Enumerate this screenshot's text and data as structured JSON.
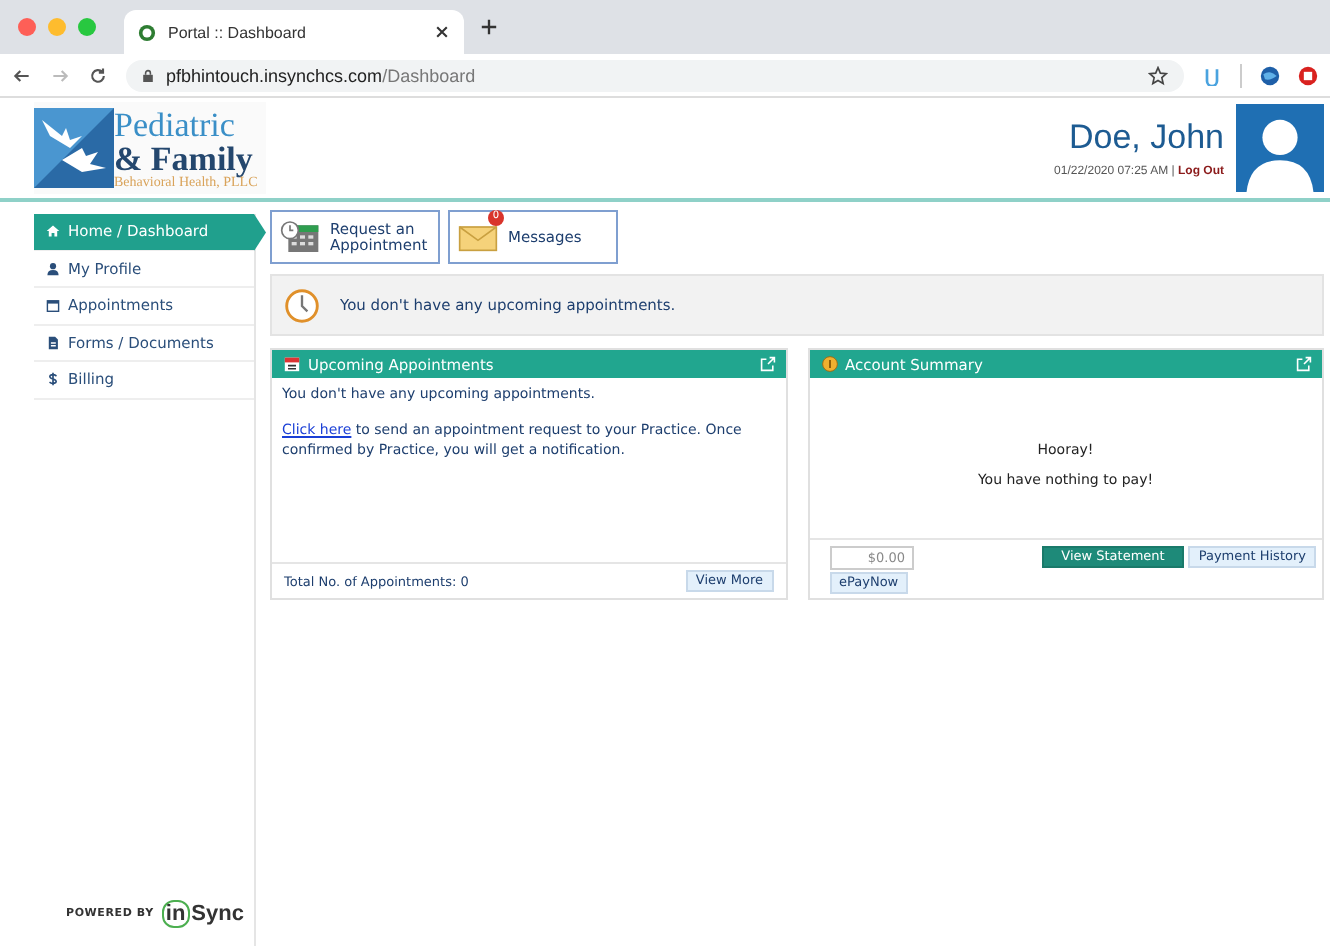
{
  "browser": {
    "tab_title": "Portal :: Dashboard",
    "url_host": "pfbhintouch.insynchcs.com",
    "url_path": "/Dashboard"
  },
  "header": {
    "logo": {
      "line1": "Pediatric",
      "line2": "& Family",
      "line3": "Behavioral Health, PLLC"
    },
    "user_name": "Doe, John",
    "datetime": "01/22/2020 07:25 AM",
    "separator": "|",
    "logout": "Log Out"
  },
  "sidebar": {
    "items": [
      {
        "label": "Home / Dashboard",
        "kind": "home",
        "selected": true
      },
      {
        "label": "My Profile",
        "kind": "user",
        "selected": false
      },
      {
        "label": "Appointments",
        "kind": "calendar",
        "selected": false
      },
      {
        "label": "Forms / Documents",
        "kind": "document",
        "selected": false
      },
      {
        "label": "Billing",
        "kind": "dollar",
        "selected": false
      }
    ],
    "powered_by": "POWERED BY",
    "brand_mark": "in",
    "brand_rest": "Sync"
  },
  "tiles": [
    {
      "kind": "calendar",
      "label": "Request an Appointment"
    },
    {
      "kind": "mail",
      "label": "Messages",
      "badge": "0"
    }
  ],
  "notice": "You don't have any upcoming appointments.",
  "upcoming": {
    "title": "Upcoming Appointments",
    "empty_text": "You don't have any upcoming appointments.",
    "link": "Click here",
    "link_rest": " to send an appointment request to your Practice. Once confirmed by Practice, you will get a notification.",
    "total": "Total No. of Appointments: 0",
    "view_more": "View More"
  },
  "account": {
    "title": "Account Summary",
    "line1": "Hooray!",
    "line2": "You have nothing to pay!",
    "amount": "$0.00",
    "view_statement": "View Statement",
    "payment_history": "Payment History",
    "epay": "ePayNow"
  }
}
